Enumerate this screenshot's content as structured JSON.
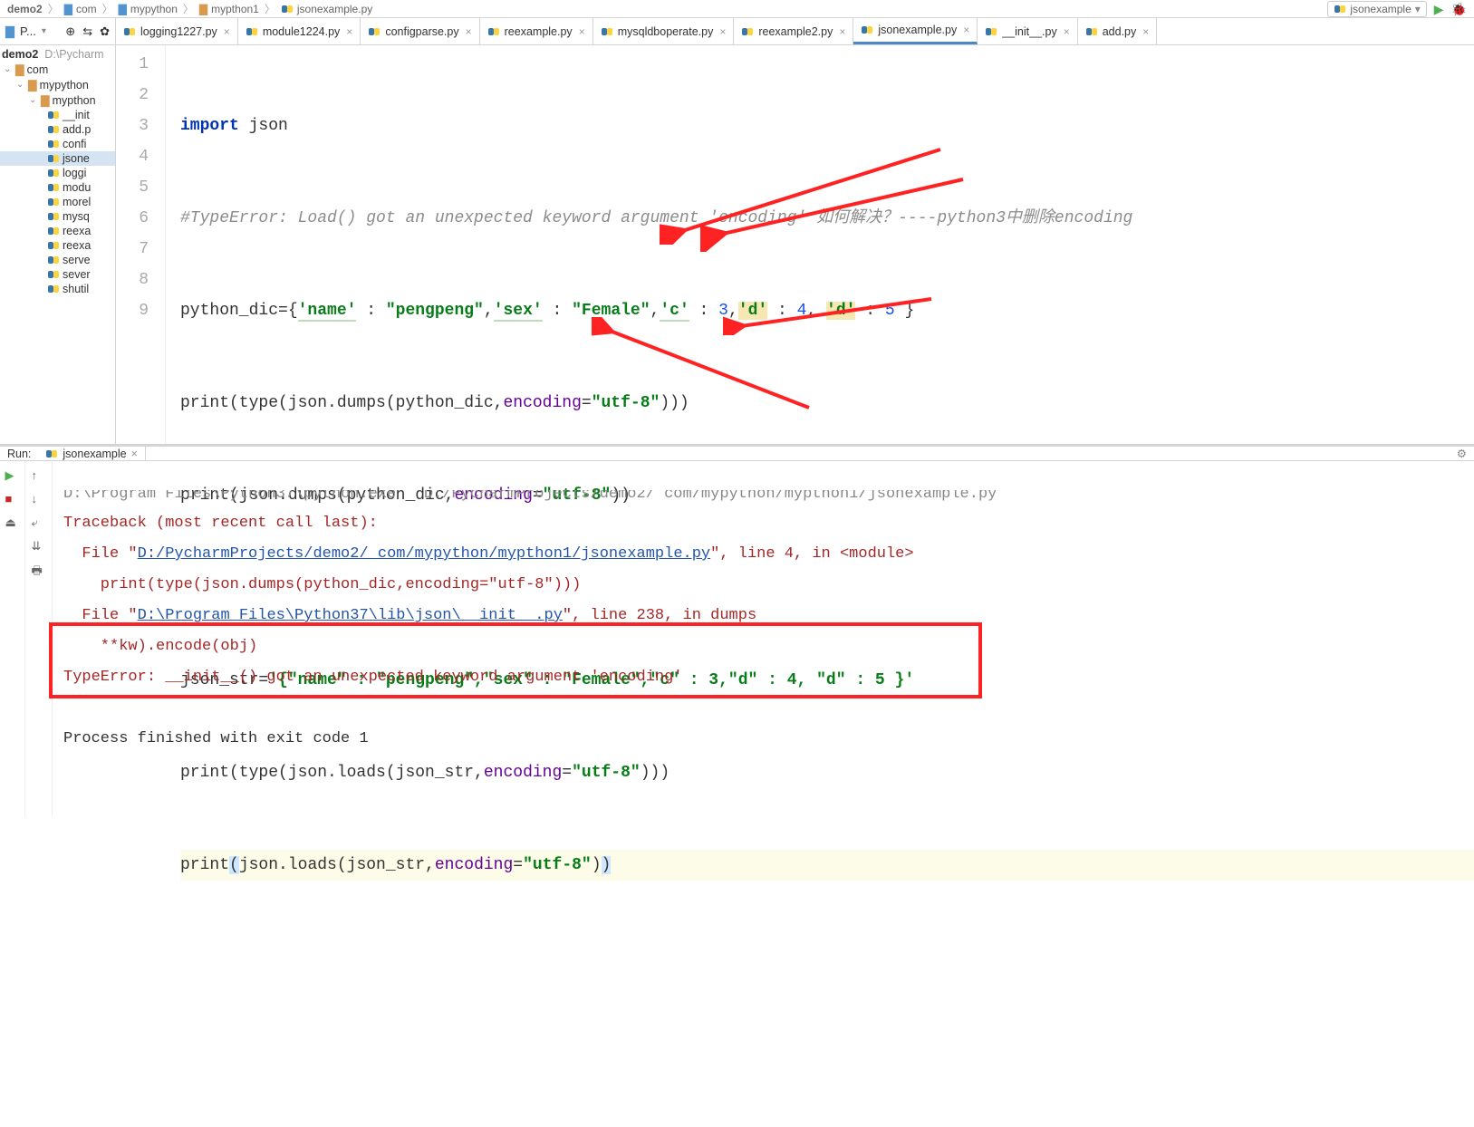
{
  "breadcrumb": [
    "demo2",
    "com",
    "mypython",
    "mypthon1",
    "jsonexample.py"
  ],
  "run_config_name": "jsonexample",
  "project_tool": {
    "label": "P..."
  },
  "editor_tabs": [
    {
      "name": "logging1227.py",
      "active": false
    },
    {
      "name": "module1224.py",
      "active": false
    },
    {
      "name": "configparse.py",
      "active": false
    },
    {
      "name": "reexample.py",
      "active": false
    },
    {
      "name": "mysqldboperate.py",
      "active": false
    },
    {
      "name": "reexample2.py",
      "active": false
    },
    {
      "name": "jsonexample.py",
      "active": true
    },
    {
      "name": "__init__.py",
      "active": false
    },
    {
      "name": "add.py",
      "active": false
    }
  ],
  "tree": {
    "root": {
      "name": "demo2",
      "path": "D:\\Pycharm"
    },
    "items": [
      {
        "name": "com",
        "type": "folder",
        "indent": 1,
        "open": true
      },
      {
        "name": "mypython",
        "type": "folder",
        "indent": 2,
        "open": true,
        "blue": true
      },
      {
        "name": "mypthon",
        "type": "folder",
        "indent": 3,
        "open": true
      },
      {
        "name": "__init",
        "type": "py",
        "indent": 4
      },
      {
        "name": "add.p",
        "type": "py",
        "indent": 4
      },
      {
        "name": "confi",
        "type": "py",
        "indent": 4
      },
      {
        "name": "jsone",
        "type": "py",
        "indent": 4,
        "selected": true
      },
      {
        "name": "loggi",
        "type": "py",
        "indent": 4
      },
      {
        "name": "modu",
        "type": "py",
        "indent": 4
      },
      {
        "name": "morel",
        "type": "py",
        "indent": 4
      },
      {
        "name": "mysq",
        "type": "py",
        "indent": 4
      },
      {
        "name": "reexa",
        "type": "py",
        "indent": 4
      },
      {
        "name": "reexa",
        "type": "py",
        "indent": 4
      },
      {
        "name": "serve",
        "type": "py",
        "indent": 4
      },
      {
        "name": "sever",
        "type": "py",
        "indent": 4
      },
      {
        "name": "shutil",
        "type": "py",
        "indent": 4
      }
    ]
  },
  "code": {
    "lines": [
      1,
      2,
      3,
      4,
      5,
      6,
      7,
      8,
      9
    ],
    "l1_kw": "import",
    "l1_mod": " json",
    "l2": "#TypeError: Load() got an unexpected keyword argument 'encoding' 如何解决？----python3中删除encoding",
    "l3_a": "python_dic={",
    "l3_k1": "'name'",
    "l3_b": " : ",
    "l3_v1": "\"pengpeng\"",
    "l3_c": ",",
    "l3_k2": "'sex'",
    "l3_d": " : ",
    "l3_v2": "\"Female\"",
    "l3_e": ",",
    "l3_k3": "'c'",
    "l3_f": " : ",
    "l3_n3": "3",
    "l3_g": ",",
    "l3_k4": "'d'",
    "l3_h": " : ",
    "l3_n4": "4",
    "l3_i": ", ",
    "l3_k5": "'d'",
    "l3_j": " : ",
    "l3_n5": "5",
    "l3_k": " }",
    "l4_a": "print(type(json.dumps(python_dic,",
    "l4_p": "encoding",
    "l4_b": "=",
    "l4_s": "\"utf-8\"",
    "l4_c": ")))",
    "l5_a": "print(json.dumps(python_dic,",
    "l5_p": "encoding",
    "l5_b": "=",
    "l5_s": "\"utf-8\"",
    "l5_c": "))",
    "l7_a": "json_str=",
    "l7_s": "'{\"name\" : \"pengpeng\",\"sex\" : \"Female\",\"c\" : 3,\"d\" : 4, \"d\" : 5 }'",
    "l8_a": "print(type(json.loads(json_str,",
    "l8_p": "encoding",
    "l8_b": "=",
    "l8_s": "\"utf-8\"",
    "l8_c": ")))",
    "l9_a": "print",
    "l9_paren_open": "(",
    "l9_b": "json.loads(json_str,",
    "l9_p": "encoding",
    "l9_c": "=",
    "l9_s": "\"utf-8\"",
    "l9_d": ")",
    "l9_paren_close": ")"
  },
  "run": {
    "label": "Run:",
    "tab_name": "jsonexample",
    "console_lines": {
      "l0": "D:\\Program Files\\Python37\\python.exe   D:/PycharmProjects/demo2/ com/mypython/mypthon1/jsonexample.py",
      "l1": "Traceback (most recent call last):",
      "l2a": "  File \"",
      "l2link": "D:/PycharmProjects/demo2/ com/mypython/mypthon1/jsonexample.py",
      "l2b": "\", line 4, in <module>",
      "l3": "    print(type(json.dumps(python_dic,encoding=\"utf-8\")))",
      "l4a": "  File \"",
      "l4link": "D:\\Program Files\\Python37\\lib\\json\\__init__.py",
      "l4b": "\", line 238, in dumps",
      "l5": "    **kw).encode(obj)",
      "l6": "TypeError: __init__() got an unexpected keyword argument 'encoding'",
      "l7": "",
      "l8": "Process finished with exit code 1"
    }
  }
}
